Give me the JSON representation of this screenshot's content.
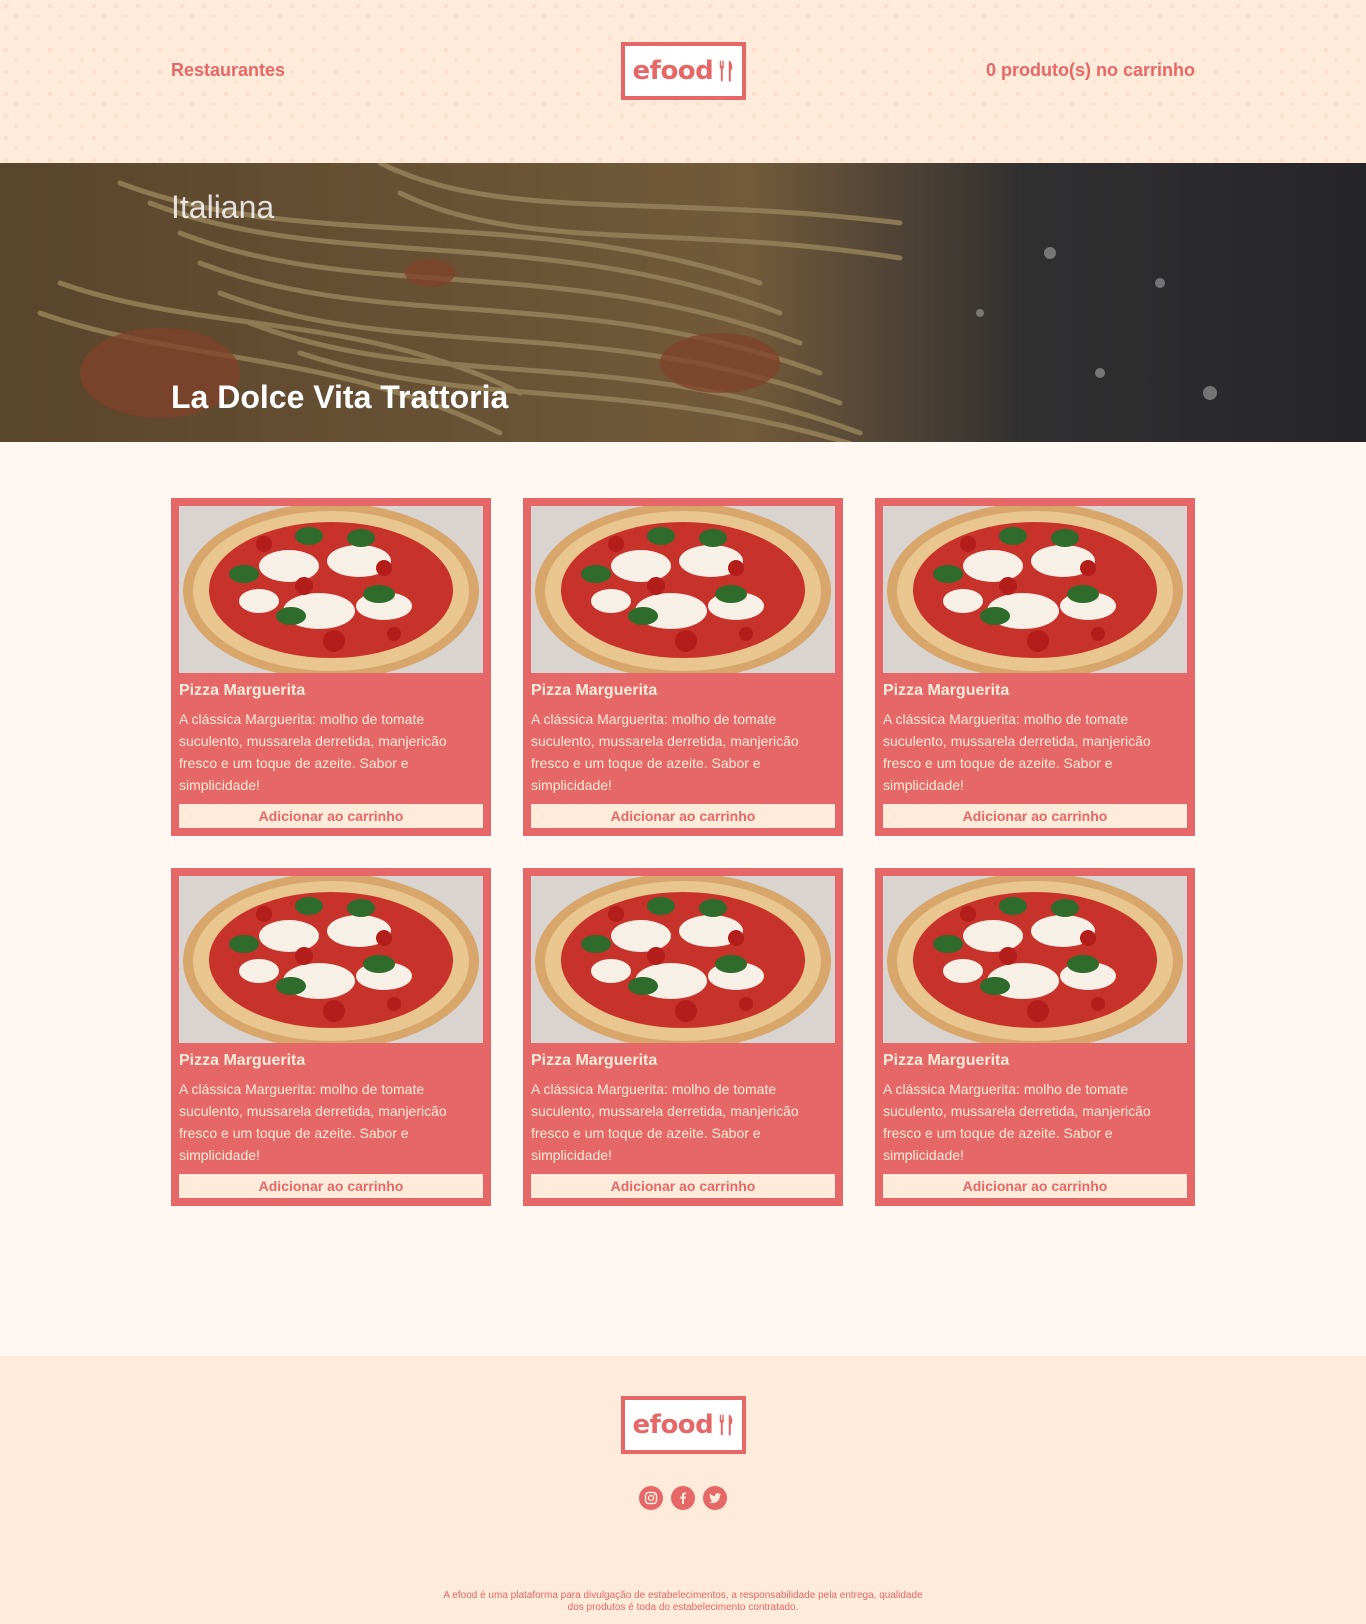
{
  "header": {
    "restaurants_link": "Restaurantes",
    "cart_label": "0 produto(s) no carrinho",
    "logo_text": "efood"
  },
  "hero": {
    "type": "Italiana",
    "restaurant_name": "La Dolce Vita Trattoria"
  },
  "products": [
    {
      "title": "Pizza Marguerita",
      "description": "A clássica Marguerita: molho de tomate suculento, mussarela derretida, manjericão fresco e um toque de azeite. Sabor e simplicidade!",
      "button": "Adicionar ao carrinho"
    },
    {
      "title": "Pizza Marguerita",
      "description": "A clássica Marguerita: molho de tomate suculento, mussarela derretida, manjericão fresco e um toque de azeite. Sabor e simplicidade!",
      "button": "Adicionar ao carrinho"
    },
    {
      "title": "Pizza Marguerita",
      "description": "A clássica Marguerita: molho de tomate suculento, mussarela derretida, manjericão fresco e um toque de azeite. Sabor e simplicidade!",
      "button": "Adicionar ao carrinho"
    },
    {
      "title": "Pizza Marguerita",
      "description": "A clássica Marguerita: molho de tomate suculento, mussarela derretida, manjericão fresco e um toque de azeite. Sabor e simplicidade!",
      "button": "Adicionar ao carrinho"
    },
    {
      "title": "Pizza Marguerita",
      "description": "A clássica Marguerita: molho de tomate suculento, mussarela derretida, manjericão fresco e um toque de azeite. Sabor e simplicidade!",
      "button": "Adicionar ao carrinho"
    },
    {
      "title": "Pizza Marguerita",
      "description": "A clássica Marguerita: molho de tomate suculento, mussarela derretida, manjericão fresco e um toque de azeite. Sabor e simplicidade!",
      "button": "Adicionar ao carrinho"
    }
  ],
  "footer": {
    "logo_text": "efood",
    "socials": [
      "instagram-icon",
      "facebook-icon",
      "twitter-icon"
    ],
    "note": "A efood é uma plataforma para divulgação de estabelecimentos, a responsabilidade pela entrega, qualidade dos produtos é toda do estabelecimento contratado."
  },
  "colors": {
    "primary": "#E66767",
    "secondary": "#FFEBD9",
    "background": "#FFF8F2"
  }
}
